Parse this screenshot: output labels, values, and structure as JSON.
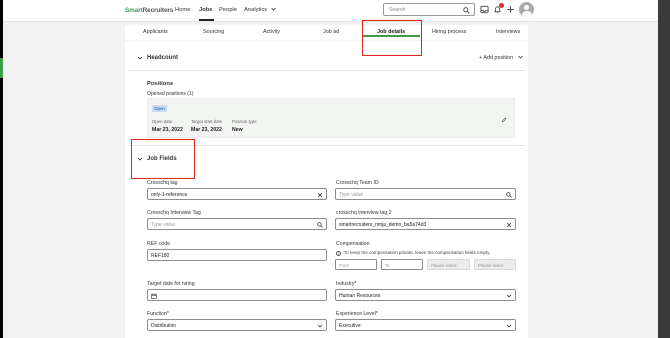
{
  "nav": {
    "logo_primary": "Smart",
    "logo_secondary": "Recruiters",
    "items": [
      "Home",
      "Jobs",
      "People",
      "Analytics"
    ],
    "active": "Jobs",
    "search_placeholder": "Search",
    "notification_count": "2"
  },
  "tabs": [
    "Applicants",
    "Sourcing",
    "Activity",
    "Job ad",
    "Job details",
    "Hiring process",
    "Interviews"
  ],
  "active_tab": "Job details",
  "headcount": {
    "title": "Headcount",
    "add_position": "Add position"
  },
  "positions": {
    "title": "Positions",
    "opened_label": "Opened positions (1)",
    "status": "Open",
    "open_date_label": "Open date",
    "open_date": "Mar 23, 2022",
    "target_start_label": "Target start date",
    "target_start": "Mar 23, 2022",
    "position_type_label": "Position type",
    "position_type": "New"
  },
  "job_fields": {
    "title": "Job Fields",
    "crosschq_tag_label": "Crosschq tag",
    "crosschq_tag_value": "only-1-reference",
    "crosschq_team_label": "Crosschq Team ID",
    "crosschq_team_placeholder": "Type value",
    "interview_tag_label": "Crosschq Interview Tag",
    "interview_tag_placeholder": "Type value",
    "interview_tag2_label": "crosschq interview tag 2",
    "interview_tag2_value": "smartrecruiters_nmja_demo_ba5a74d3",
    "ref_code_label": "REF code",
    "ref_code_value": "REF180",
    "compensation_label": "Compensation",
    "compensation_note": "To keep the compensation private, leave the compensation fields empty.",
    "from_placeholder": "From",
    "to_placeholder": "To",
    "select_placeholder_1": "Please select",
    "select_placeholder_2": "Please select",
    "target_hiring_label": "Target date for hiring",
    "industry_label": "Industry*",
    "industry_value": "Human Resources",
    "function_label": "Function*",
    "function_value": "Distribution",
    "experience_label": "Experience Level*",
    "experience_value": "Executive"
  },
  "colors": {
    "brand_green": "#3f9b4b",
    "annotation_red": "#e2291d",
    "status_badge": "#c9dbf5"
  }
}
